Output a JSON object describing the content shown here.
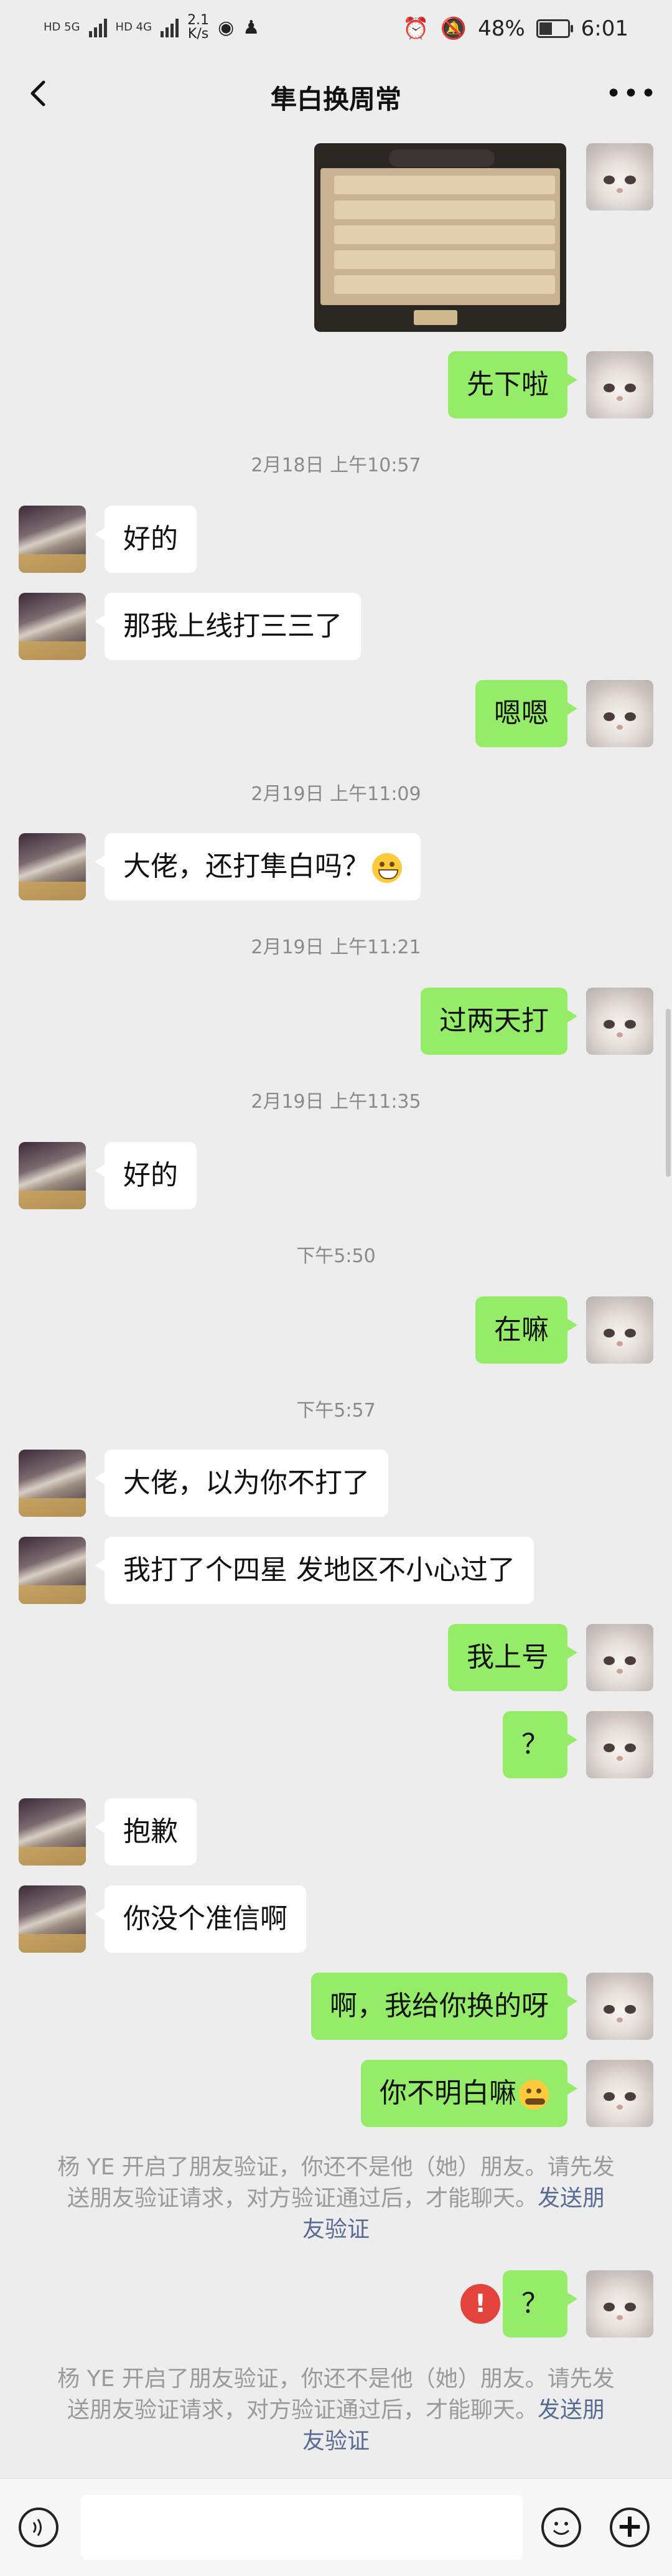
{
  "status_bar": {
    "sim1": "HD 5G",
    "sim2": "HD 4G",
    "speed": "2.1",
    "speed_unit": "K/s",
    "battery": "48%",
    "battery_level": 0.48,
    "time": "6:01"
  },
  "header": {
    "title": "隼白换周常"
  },
  "chat": {
    "ts1": "2月18日 上午10:57",
    "ts2": "2月19日 上午11:09",
    "ts3": "2月19日 上午11:21",
    "ts4": "2月19日 上午11:35",
    "ts5": "下午5:50",
    "ts6": "下午5:57",
    "m_out_1": "先下啦",
    "m_in_1": "好的",
    "m_in_2": "那我上线打三三了",
    "m_out_2": "嗯嗯",
    "m_in_3": "大佬，还打隼白吗？",
    "m_out_3": "过两天打",
    "m_in_4": "好的",
    "m_out_4": "在嘛",
    "m_in_5": "大佬，以为你不打了",
    "m_in_6": "我打了个四星 发地区不小心过了",
    "m_out_5": "我上号",
    "m_out_6": "？",
    "m_in_7": "抱歉",
    "m_in_8": "你没个准信啊",
    "m_out_7": "啊，我给你换的呀",
    "m_out_8": "你不明白嘛",
    "m_out_9": "？",
    "sys_text": "杨 YE 开启了朋友验证，你还不是他（她）朋友。请先发送朋友验证请求，对方验证通过后，才能聊天。",
    "sys_link": "发送朋友验证",
    "failed_mark": "!"
  },
  "icons": {
    "back": "back-arrow-icon",
    "more": "more-dots-icon",
    "voice": "voice-icon",
    "emoji": "emoji-icon",
    "plus": "plus-icon"
  },
  "colors": {
    "out_bubble": "#95EC69",
    "in_bubble": "#FFFFFF",
    "background": "#EDEDED",
    "link": "#576B95",
    "error": "#E4433B"
  }
}
